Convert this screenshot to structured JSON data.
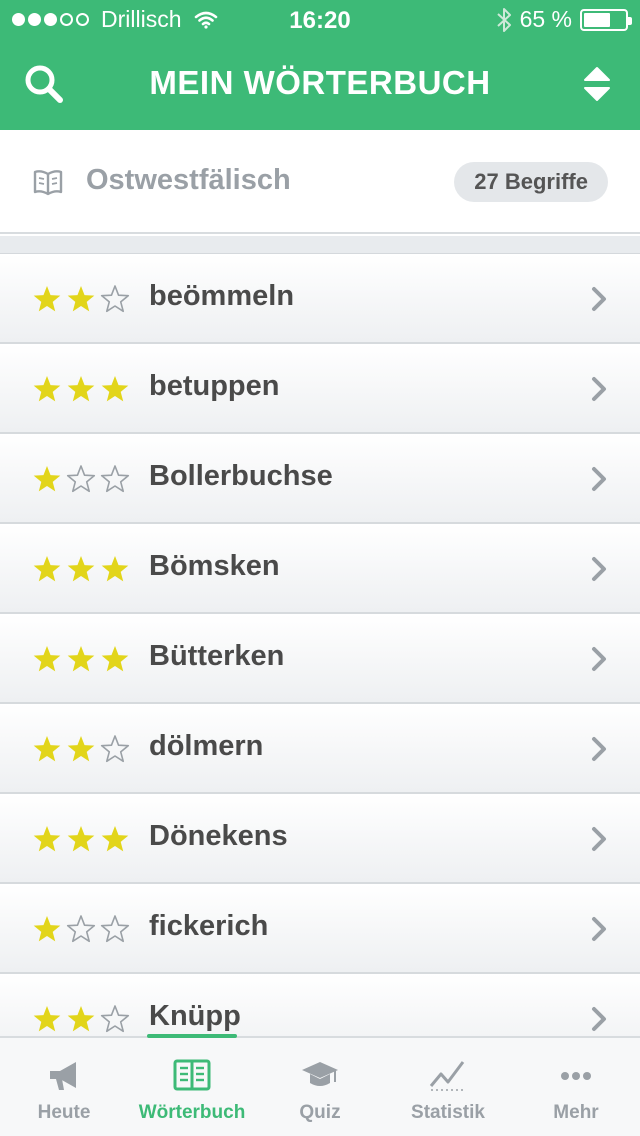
{
  "status_bar": {
    "carrier": "Drillisch",
    "time": "16:20",
    "battery_percent_text": "65 %",
    "battery_level": 0.65,
    "signal_bars_filled": 3,
    "signal_bars_total": 5
  },
  "nav": {
    "title": "MEIN WÖRTERBUCH",
    "search_icon": "search-icon",
    "sort_icon": "sort-icon"
  },
  "dictionary": {
    "name": "Ostwestfälisch",
    "count_label": "27 Begriffe",
    "icon": "book-icon"
  },
  "words": [
    {
      "word": "beömmeln",
      "rating": 2
    },
    {
      "word": "betuppen",
      "rating": 3
    },
    {
      "word": "Bollerbuchse",
      "rating": 1
    },
    {
      "word": "Bömsken",
      "rating": 3
    },
    {
      "word": "Bütterken",
      "rating": 3
    },
    {
      "word": "dölmern",
      "rating": 2
    },
    {
      "word": "Dönekens",
      "rating": 3
    },
    {
      "word": "fickerich",
      "rating": 1
    },
    {
      "word": "Knüpp",
      "rating": 2
    }
  ],
  "tabs": [
    {
      "label": "Heute",
      "icon": "megaphone-icon",
      "active": false
    },
    {
      "label": "Wörterbuch",
      "icon": "book-icon",
      "active": true
    },
    {
      "label": "Quiz",
      "icon": "graduation-cap-icon",
      "active": false
    },
    {
      "label": "Statistik",
      "icon": "chart-line-icon",
      "active": false
    },
    {
      "label": "Mehr",
      "icon": "more-dots-icon",
      "active": false
    }
  ],
  "colors": {
    "brand_green": "#3dba77",
    "star_filled": "#e2d51a",
    "star_empty": "#9aa0a6",
    "inactive_gray": "#9aa0a6"
  }
}
